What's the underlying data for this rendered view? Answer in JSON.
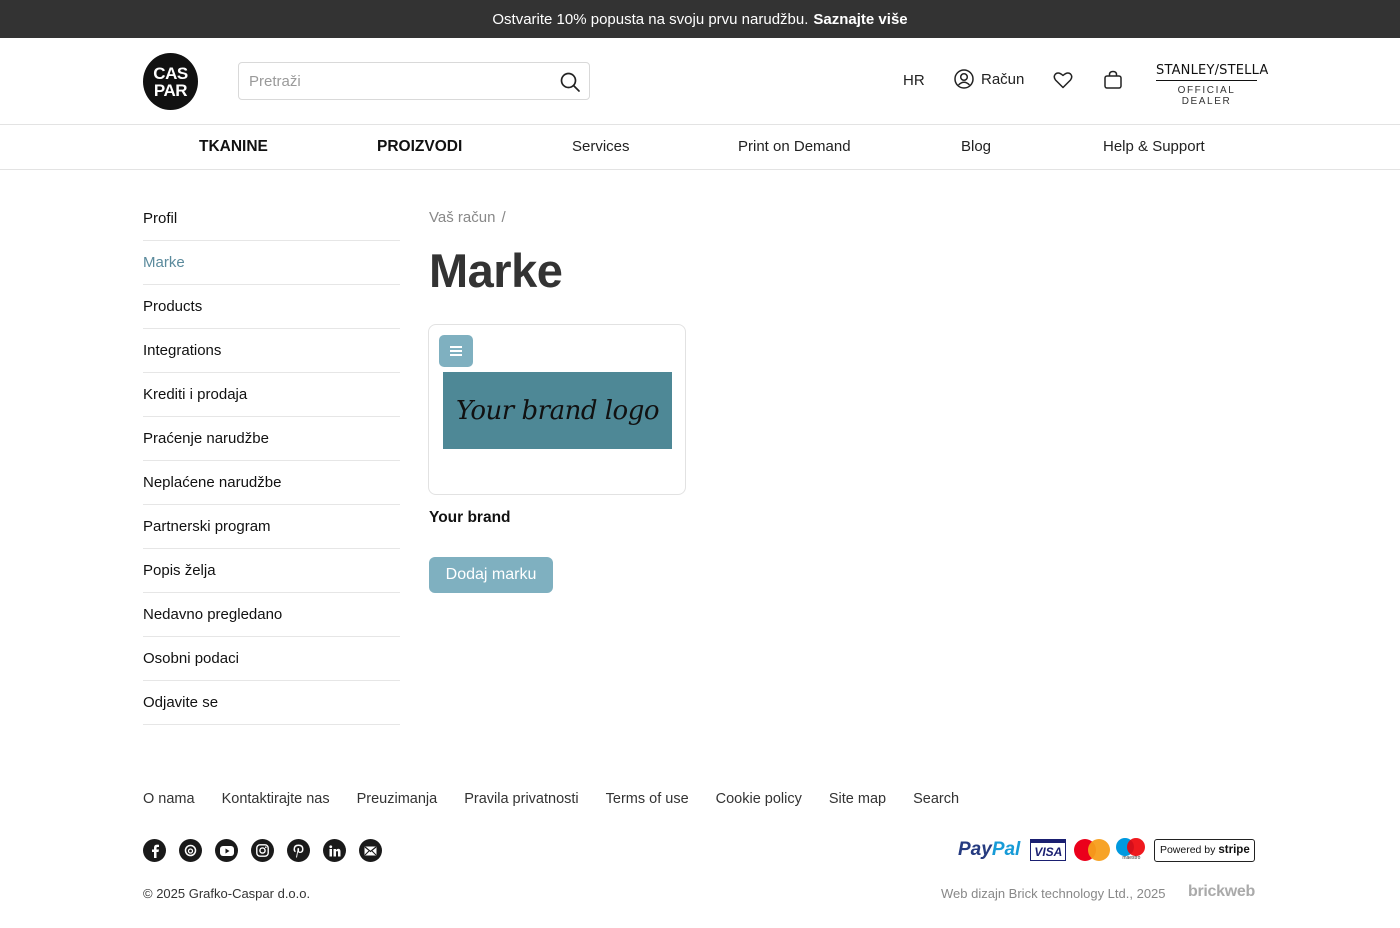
{
  "promo": {
    "text": "Ostvarite 10% popusta na svoju prvu narudžbu.",
    "link": "Saznajte više"
  },
  "header": {
    "logo_line1": "CAS",
    "logo_line2": "PAR",
    "search_placeholder": "Pretraži",
    "lang": "HR",
    "account_label": "Račun",
    "dealer_brand": "STANLEY/STELLA",
    "dealer_sub": "OFFICIAL DEALER"
  },
  "nav": {
    "items": [
      "TKANINE",
      "PROIZVODI",
      "Services",
      "Print on Demand",
      "Blog",
      "Help & Support"
    ]
  },
  "sidebar": {
    "items": [
      "Profil",
      "Marke",
      "Products",
      "Integrations",
      "Krediti i prodaja",
      "Praćenje narudžbe",
      "Neplaćene narudžbe",
      "Partnerski program",
      "Popis želja",
      "Nedavno pregledano",
      "Osobni podaci",
      "Odjavite se"
    ],
    "active": "Marke"
  },
  "main": {
    "breadcrumb": "Vaš račun",
    "breadcrumb_sep": "/",
    "title": "Marke",
    "brand_logo_text": "Your brand logo",
    "brand_name": "Your brand",
    "add_button": "Dodaj marku"
  },
  "footer": {
    "links": [
      "O nama",
      "Kontaktirajte nas",
      "Preuzimanja",
      "Pravila privatnosti",
      "Terms of use",
      "Cookie policy",
      "Site map",
      "Search"
    ],
    "socials": [
      "facebook-icon",
      "threads-icon",
      "youtube-icon",
      "instagram-icon",
      "pinterest-icon",
      "linkedin-icon",
      "email-icon"
    ],
    "paypal_a": "Pay",
    "paypal_b": "Pal",
    "visa": "VISA",
    "maestro": "maestro",
    "stripe_a": "Powered by",
    "stripe_b": "stripe",
    "copyright": "© 2025  Grafko-Caspar d.o.o.",
    "credit": "Web dizajn Brick technology Ltd., 2025",
    "credit_brand": "brickweb"
  },
  "colors": {
    "accent": "#7fb0c0",
    "active_link": "#5a8a9c",
    "promo_bg": "#333333",
    "logo_bg": "#4e8896"
  }
}
